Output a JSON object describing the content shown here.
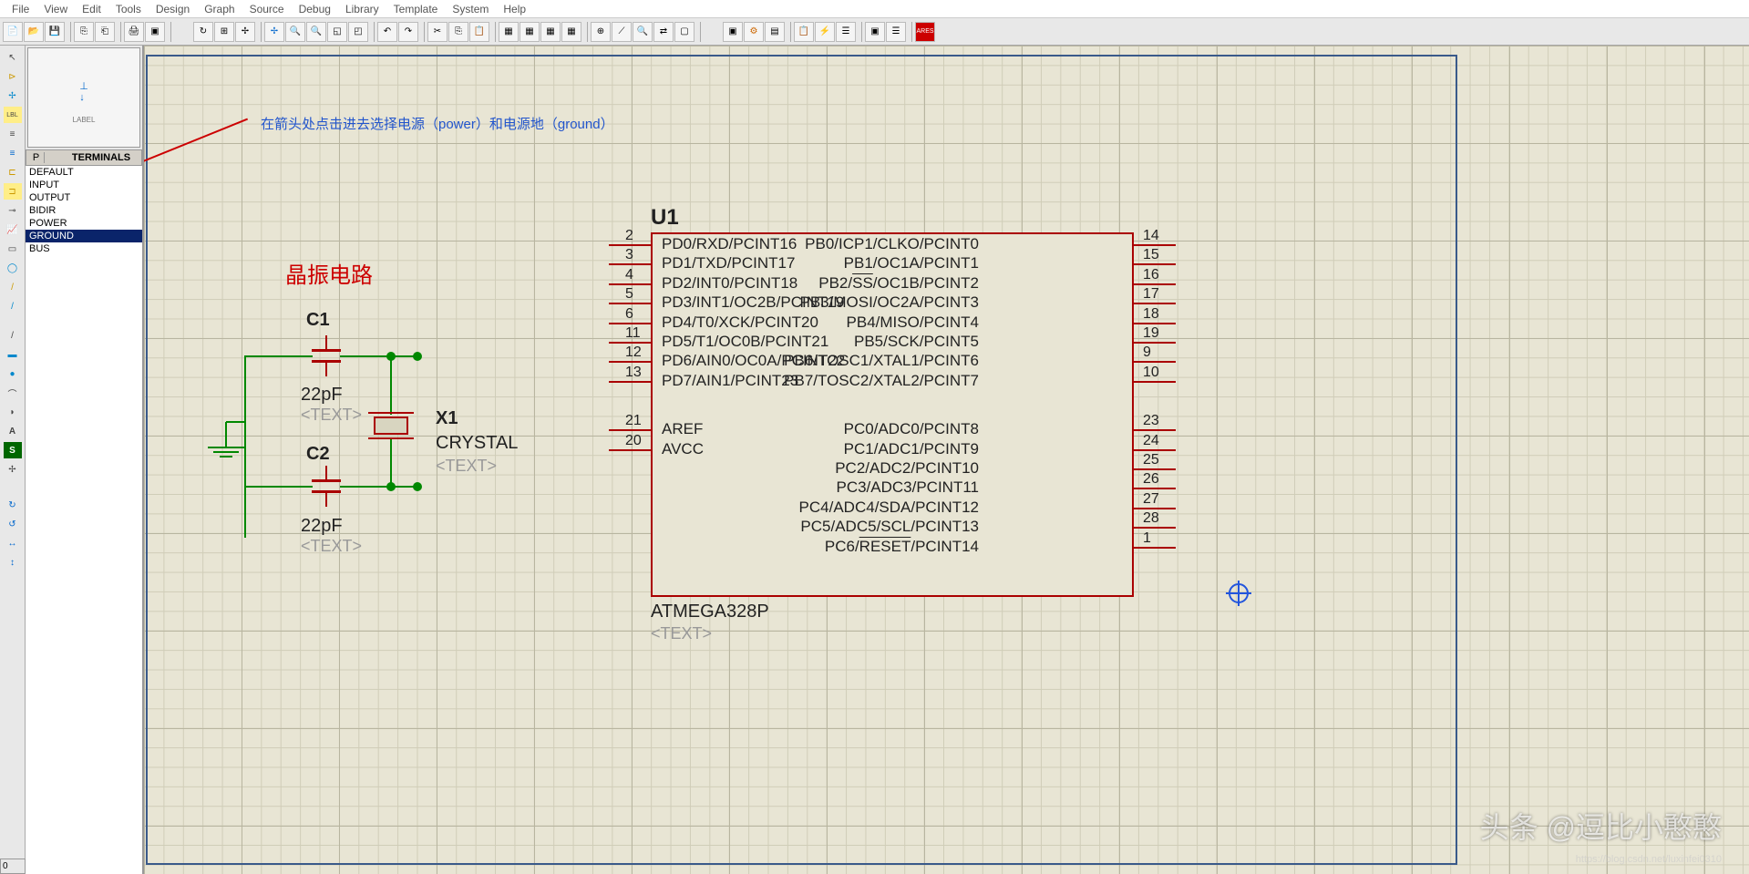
{
  "menu": [
    "File",
    "View",
    "Edit",
    "Tools",
    "Design",
    "Graph",
    "Source",
    "Debug",
    "Library",
    "Template",
    "System",
    "Help"
  ],
  "terminals": {
    "header_p": "P",
    "header_title": "TERMINALS",
    "items": [
      "DEFAULT",
      "INPUT",
      "OUTPUT",
      "BIDIR",
      "POWER",
      "GROUND",
      "BUS"
    ],
    "selected": 5
  },
  "preview": {
    "label": "LABEL"
  },
  "annotation": "在箭头处点击进去选择电源（power）和电源地（ground）",
  "circuit_title": "晶振电路",
  "components": {
    "c1": {
      "name": "C1",
      "value": "22pF",
      "text": "<TEXT>"
    },
    "c2": {
      "name": "C2",
      "value": "22pF",
      "text": "<TEXT>"
    },
    "x1": {
      "name": "X1",
      "value": "CRYSTAL",
      "text": "<TEXT>"
    },
    "u1": {
      "name": "U1",
      "part": "ATMEGA328P",
      "text": "<TEXT>"
    }
  },
  "chip": {
    "left_pins": [
      {
        "num": "2",
        "name": "PD0/RXD/PCINT16"
      },
      {
        "num": "3",
        "name": "PD1/TXD/PCINT17"
      },
      {
        "num": "4",
        "name": "PD2/INT0/PCINT18"
      },
      {
        "num": "5",
        "name": "PD3/INT1/OC2B/PCINT19"
      },
      {
        "num": "6",
        "name": "PD4/T0/XCK/PCINT20"
      },
      {
        "num": "11",
        "name": "PD5/T1/OC0B/PCINT21"
      },
      {
        "num": "12",
        "name": "PD6/AIN0/OC0A/PCINT22"
      },
      {
        "num": "13",
        "name": "PD7/AIN1/PCINT23"
      },
      {
        "num": "21",
        "name": "AREF"
      },
      {
        "num": "20",
        "name": "AVCC"
      }
    ],
    "right_pins": [
      {
        "num": "14",
        "name": "PB0/ICP1/CLKO/PCINT0"
      },
      {
        "num": "15",
        "name": "PB1/OC1A/PCINT1"
      },
      {
        "num": "16",
        "name": "PB2/SS/OC1B/PCINT2",
        "ov": "SS"
      },
      {
        "num": "17",
        "name": "PB3/MOSI/OC2A/PCINT3"
      },
      {
        "num": "18",
        "name": "PB4/MISO/PCINT4"
      },
      {
        "num": "19",
        "name": "PB5/SCK/PCINT5"
      },
      {
        "num": "9",
        "name": "PB6/TOSC1/XTAL1/PCINT6"
      },
      {
        "num": "10",
        "name": "PB7/TOSC2/XTAL2/PCINT7"
      },
      {
        "num": "23",
        "name": "PC0/ADC0/PCINT8"
      },
      {
        "num": "24",
        "name": "PC1/ADC1/PCINT9"
      },
      {
        "num": "25",
        "name": "PC2/ADC2/PCINT10"
      },
      {
        "num": "26",
        "name": "PC3/ADC3/PCINT11"
      },
      {
        "num": "27",
        "name": "PC4/ADC4/SDA/PCINT12"
      },
      {
        "num": "28",
        "name": "PC5/ADC5/SCL/PCINT13"
      },
      {
        "num": "1",
        "name": "PC6/RESET/PCINT14",
        "ov": "RESET"
      }
    ]
  },
  "coord": "0",
  "watermark": "头条 @逗比小憨憨",
  "watermark_sub": "https://blog.csdn.net/luxinfei0310"
}
